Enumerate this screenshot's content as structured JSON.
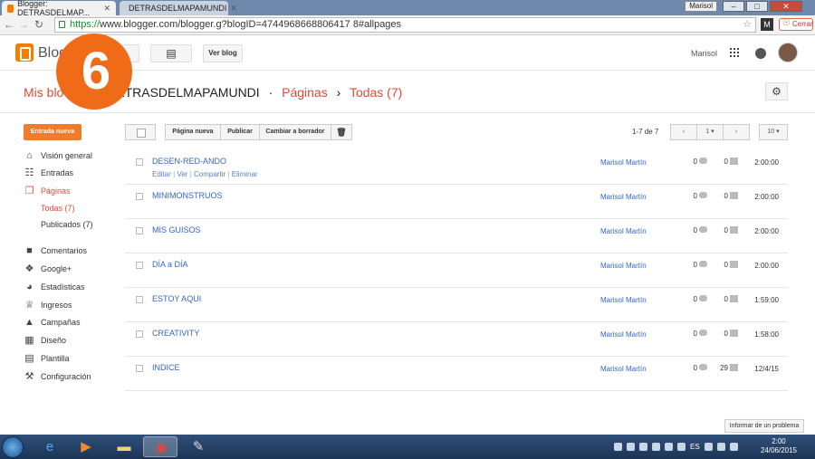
{
  "browser": {
    "tabs": [
      {
        "label": "Blogger: DETRASDELMAP..."
      },
      {
        "label": "DETRASDELMAPAMUNDI"
      }
    ],
    "user_badge": "Marisol",
    "url_scheme": "https://",
    "url_rest": "www.blogger.com/blogger.g?blogID=4744968668806417 8#allpages",
    "close_ext_label": "Cerrar"
  },
  "header": {
    "brand": "Blog",
    "view_blog_label": "Ver blog",
    "user_name": "Marisol"
  },
  "overlay_badge": "6",
  "breadcrumb": {
    "root": "Mis blo",
    "blog": "DETRASDELMAPAMUNDI",
    "section": "Páginas",
    "current": "Todas (7)",
    "separator1": "·",
    "separator2": "›"
  },
  "sidebar": {
    "new_post_label": "Entrada nueva",
    "items": [
      {
        "label": "Visión general",
        "icon": "home-icon",
        "glyph": "⌂"
      },
      {
        "label": "Entradas",
        "icon": "posts-icon",
        "glyph": "☷"
      },
      {
        "label": "Páginas",
        "icon": "pages-icon",
        "glyph": "❐"
      },
      {
        "label": "Comentarios",
        "icon": "comment-icon",
        "glyph": "■"
      },
      {
        "label": "Google+",
        "icon": "google-plus-icon",
        "glyph": "❖"
      },
      {
        "label": "Estadísticas",
        "icon": "stats-icon",
        "glyph": "◕"
      },
      {
        "label": "Ingresos",
        "icon": "trophy-icon",
        "glyph": "♕"
      },
      {
        "label": "Campañas",
        "icon": "campaign-icon",
        "glyph": "▲"
      },
      {
        "label": "Diseño",
        "icon": "layout-icon",
        "glyph": "▦"
      },
      {
        "label": "Plantilla",
        "icon": "template-icon",
        "glyph": "▤"
      },
      {
        "label": "Configuración",
        "icon": "wrench-icon",
        "glyph": "⚒"
      }
    ],
    "subitems": [
      {
        "label": "Todas (7)"
      },
      {
        "label": "Publicados (7)"
      }
    ]
  },
  "toolbar": {
    "new_page_label": "Página nueva",
    "publish_label": "Publicar",
    "draft_label": "Cambiar a borrador",
    "count_label": "1-7 de 7",
    "page_num": "1",
    "per_page": "10"
  },
  "pages": [
    {
      "title": "DESEN-RED-ANDO",
      "author": "Marisol Martín",
      "comments": "0",
      "views": "0",
      "time": "2:00:00",
      "actions": {
        "edit": "Editar",
        "view": "Ver",
        "share": "Compartir",
        "delete": "Eliminar",
        "sep": "|"
      }
    },
    {
      "title": "MINIMONSTRUOS",
      "author": "Marisol Martín",
      "comments": "0",
      "views": "0",
      "time": "2:00:00"
    },
    {
      "title": "MIS GUISOS",
      "author": "Marisol Martín",
      "comments": "0",
      "views": "0",
      "time": "2:00:00"
    },
    {
      "title": "DÍA a DÍA",
      "author": "Marisol Martín",
      "comments": "0",
      "views": "0",
      "time": "2:00:00"
    },
    {
      "title": "ESTOY AQUI",
      "author": "Marisol Martín",
      "comments": "0",
      "views": "0",
      "time": "1:59:00"
    },
    {
      "title": "CREATIVITY",
      "author": "Marisol Martín",
      "comments": "0",
      "views": "0",
      "time": "1:58:00"
    },
    {
      "title": "INDICE",
      "author": "Marisol Martín",
      "comments": "0",
      "views": "29",
      "time": "12/4/15"
    }
  ],
  "report_problem_label": "Informar de un problema",
  "taskbar": {
    "lang": "ES",
    "time": "2:00",
    "date": "24/06/2015"
  },
  "colors": {
    "accent": "#dd4b39",
    "new_post": "#f07b2c",
    "link": "#3366cc"
  }
}
